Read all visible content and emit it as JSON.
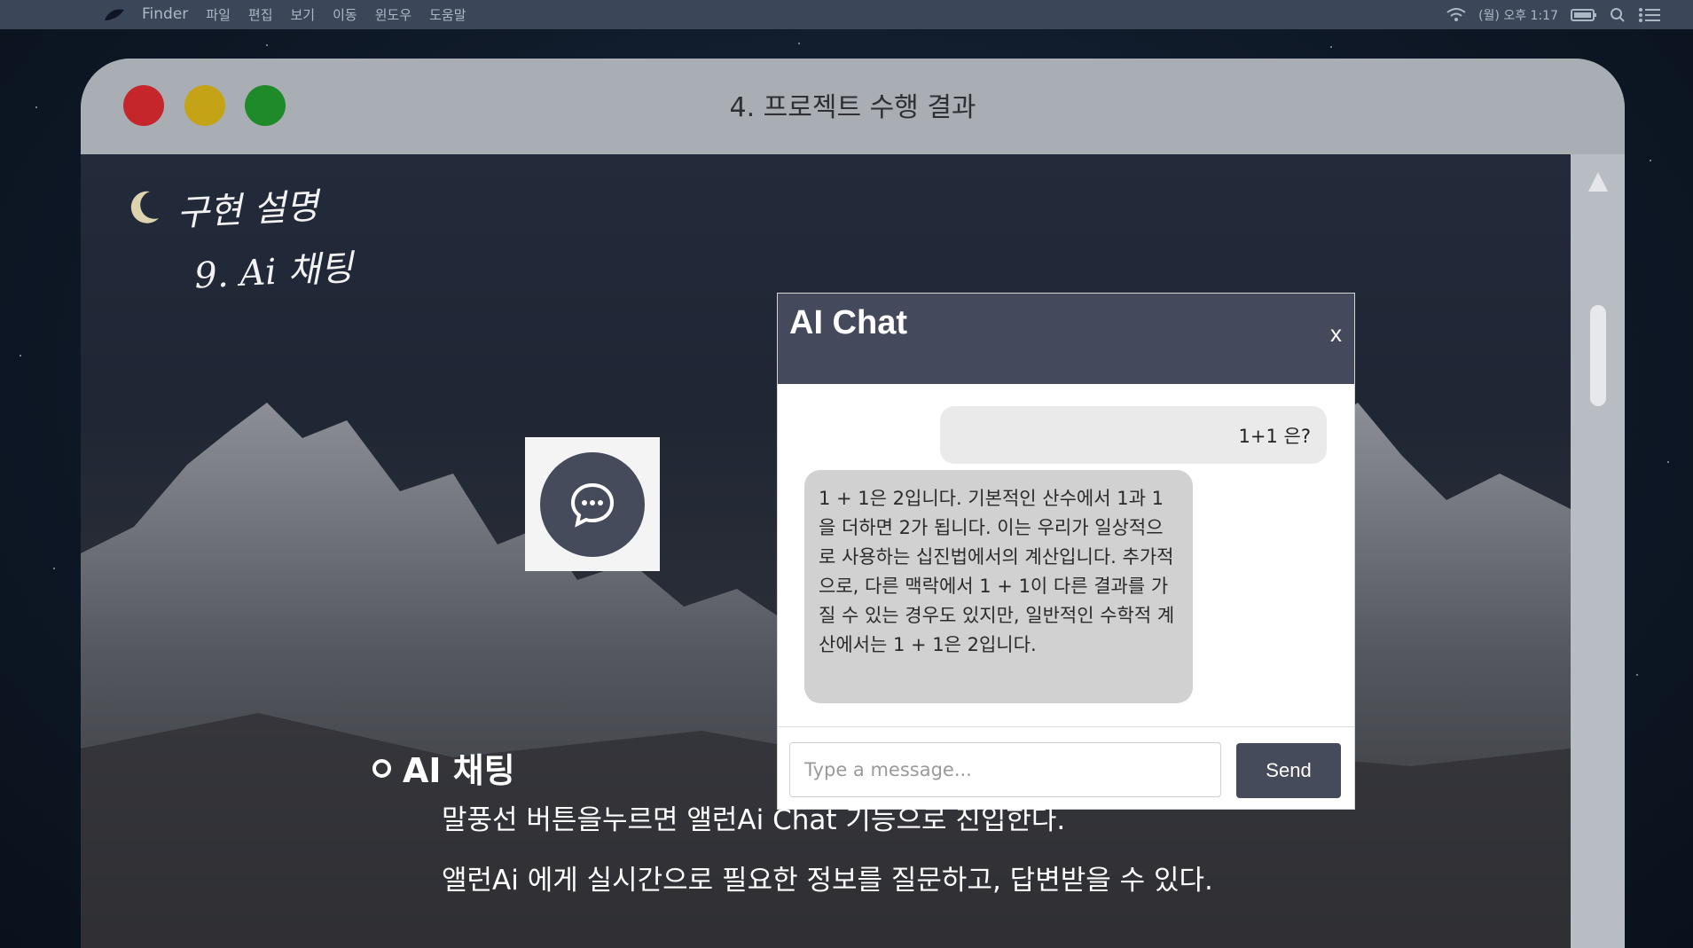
{
  "menubar": {
    "app_name": "Finder",
    "items": [
      "파일",
      "편집",
      "보기",
      "이동",
      "윈도우",
      "도움말"
    ],
    "clock": "(월) 오후 1:17"
  },
  "window": {
    "title": "4. 프로젝트 수행 결과"
  },
  "heading": {
    "line1": "구현 설명",
    "line2": "9. Ai 채팅"
  },
  "chat": {
    "title": "AI Chat",
    "close_label": "x",
    "messages": {
      "user": "1+1 은?",
      "ai": "1 + 1은 2입니다. 기본적인 산수에서 1과 1을 더하면 2가 됩니다. 이는 우리가 일상적으로 사용하는 십진법에서의 계산입니다. 추가적으로, 다른 맥락에서 1 + 1이 다른 결과를 가질 수 있는 경우도 있지만, 일반적인 수학적 계산에서는 1 + 1은 2입니다."
    },
    "input_placeholder": "Type a message...",
    "send_label": "Send"
  },
  "section": {
    "title": "AI 채팅",
    "desc_line1": "말풍선 버튼을누르면 앨런Ai Chat 기능으로 진입한다.",
    "desc_line2": "앨런Ai 에게 실시간으로 필요한 정보를 질문하고, 답변받을 수 있다."
  },
  "colors": {
    "accent": "#464b5c",
    "close_red": "#c4262b",
    "minimize_yellow": "#c4a316",
    "zoom_green": "#1f8a2a"
  }
}
